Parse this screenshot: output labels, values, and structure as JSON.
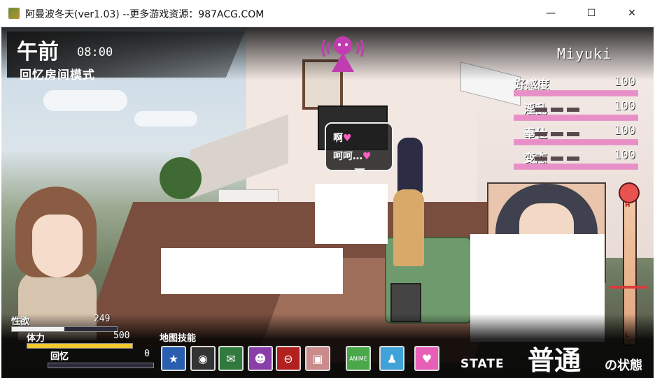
{
  "window": {
    "title": "阿曼波冬天(ver1.03)  --更多游戏资源：987ACG.COM",
    "controls": [
      "—",
      "☐",
      "✕"
    ]
  },
  "hud": {
    "period": "午前",
    "clock": "08:00",
    "mode": "回忆房间模式",
    "character_name": "Miyuki"
  },
  "stats": [
    {
      "label": "好感度",
      "value": "100",
      "level": 1.0
    },
    {
      "label": "淫乱",
      "value": "100",
      "level": 1.0
    },
    {
      "label": "奉仕",
      "value": "100",
      "level": 1.0
    },
    {
      "label": "变态",
      "value": "100",
      "level": 1.0
    }
  ],
  "bubble": {
    "line1": "啊",
    "line2": "呵呵…",
    "heart": "♥"
  },
  "arousal_gauge": {
    "top_label": "H",
    "bottom_label": "L",
    "level": 0.38,
    "color": "#e9524e"
  },
  "player": {
    "lust_label": "性欲",
    "lust_value": "249",
    "lust_level": 0.5,
    "stamina_label": "体力",
    "stamina_value": "500",
    "stamina_level": 1.0,
    "memory_label": "回忆",
    "memory_value": "0",
    "memory_level": 0.0
  },
  "skills": {
    "label": "地图技能",
    "items": [
      {
        "icon": "sleep-icon",
        "glyph": "★",
        "color": "#2a5fb0"
      },
      {
        "icon": "camera-icon",
        "glyph": "◉",
        "color": "#333333"
      },
      {
        "icon": "map-icon",
        "glyph": "✉",
        "color": "#2f7a3c"
      },
      {
        "icon": "person-icon",
        "glyph": "☻",
        "color": "#8a3fa8"
      },
      {
        "icon": "stop-icon",
        "glyph": "⊖",
        "color": "#b32020"
      },
      {
        "icon": "photo-icon",
        "glyph": "▣",
        "color": "#c98b8b"
      },
      {
        "icon": "anime-icon",
        "glyph": "ANIME",
        "color": "#4aa84a"
      },
      {
        "icon": "shirt-blue-icon",
        "glyph": "♟",
        "color": "#3fa3d9"
      },
      {
        "icon": "shirt-pink-icon",
        "glyph": "♥",
        "color": "#e85fb8"
      }
    ]
  },
  "state": {
    "prefix": "STATE",
    "main": "普通",
    "suffix": "の状態"
  }
}
